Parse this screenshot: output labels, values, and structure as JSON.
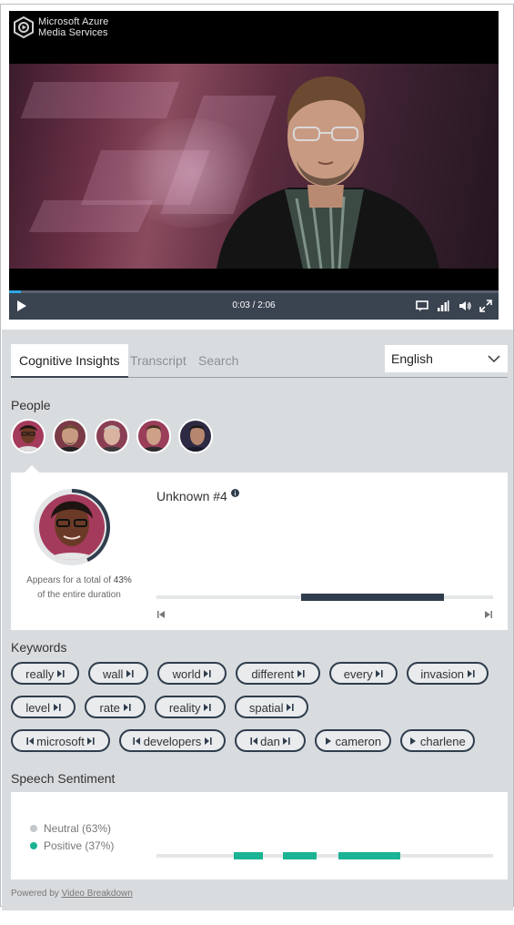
{
  "player": {
    "brand_line1": "Microsoft Azure",
    "brand_line2": "Media Services",
    "time": "0:03 / 2:06",
    "progress_fraction": 0.025,
    "icons": [
      "play-icon",
      "caption-icon",
      "quality-icon",
      "volume-icon",
      "fullscreen-icon"
    ]
  },
  "tabs": [
    {
      "label": "Cognitive Insights",
      "active": true
    },
    {
      "label": "Transcript",
      "active": false
    },
    {
      "label": "Search",
      "active": false
    }
  ],
  "language": {
    "selected": "English"
  },
  "people": {
    "title": "People",
    "selected": {
      "name": "Unknown #4",
      "appear_text_pre": "Appears for a total of ",
      "appear_percent": "43%",
      "appear_text_post": "of the entire duration",
      "appearance_fraction": 0.43,
      "timeline": [
        {
          "start": 0.43,
          "end": 0.855
        }
      ]
    }
  },
  "keywords": {
    "title": "Keywords",
    "rows": [
      [
        {
          "label": "really",
          "nav": "next"
        },
        {
          "label": "wall",
          "nav": "next"
        },
        {
          "label": "world",
          "nav": "next"
        },
        {
          "label": "different",
          "nav": "next"
        },
        {
          "label": "every",
          "nav": "next"
        },
        {
          "label": "invasion",
          "nav": "next"
        }
      ],
      [
        {
          "label": "level",
          "nav": "next"
        },
        {
          "label": "rate",
          "nav": "next"
        },
        {
          "label": "reality",
          "nav": "next"
        },
        {
          "label": "spatial",
          "nav": "next"
        }
      ],
      [
        {
          "label": "microsoft",
          "nav": "both"
        },
        {
          "label": "developers",
          "nav": "both"
        },
        {
          "label": "dan",
          "nav": "both"
        },
        {
          "label": "cameron",
          "nav": "play"
        },
        {
          "label": "charlene",
          "nav": "play"
        }
      ]
    ]
  },
  "sentiment": {
    "title": "Speech Sentiment",
    "neutral_label": "Neutral (63%)",
    "positive_label": "Positive (37%)",
    "neutral_color": "#c4c8cc",
    "positive_color": "#1ab394",
    "positive_segments": [
      {
        "start": 0.23,
        "end": 0.315
      },
      {
        "start": 0.375,
        "end": 0.475
      },
      {
        "start": 0.54,
        "end": 0.725
      }
    ]
  },
  "footer": {
    "powered_prefix": "Powered by ",
    "powered_link": "Video Breakdown"
  },
  "colors": {
    "accent": "#2ea8e0",
    "dark": "#2f3d4c",
    "panel": "#d9dcdf"
  }
}
